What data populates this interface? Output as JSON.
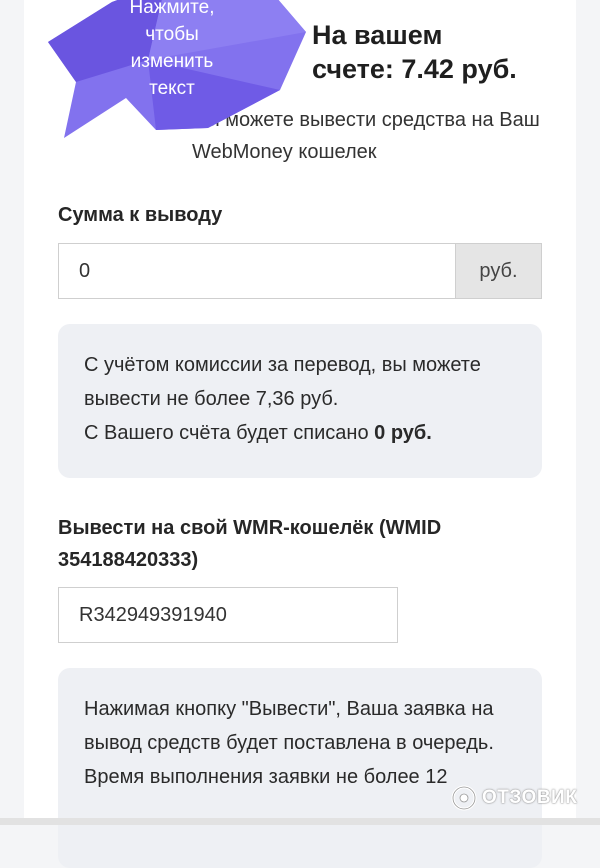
{
  "bubble": {
    "text_line1": "Нажмите,",
    "text_line2": "чтобы",
    "text_line3": "изменить",
    "text_line4": "текст",
    "color": "#7b68ee"
  },
  "balance": {
    "line1": "На вашем",
    "line2": "счете: 7.42 руб."
  },
  "hint": "Вы можете вывести средства на Ваш WebMoney кошелек",
  "amount": {
    "label": "Сумма к выводу",
    "value": "0",
    "suffix": "руб."
  },
  "commission_box": {
    "line1": "С учётом комиссии за перевод, вы можете вывести не более 7,36 руб.",
    "line2_prefix": "С Вашего счёта будет списано ",
    "line2_amount": "0 руб."
  },
  "wallet": {
    "label": "Вывести на свой WMR-кошелёк (WMID 354188420333)",
    "value": "R342949391940"
  },
  "notice_box": {
    "text": "Нажимая кнопку \"Вывести\", Ваша заявка на вывод средств будет поставлена в очередь. Время выполнения заявки не более 12"
  },
  "watermark": {
    "text": "ОТЗОВИК"
  }
}
